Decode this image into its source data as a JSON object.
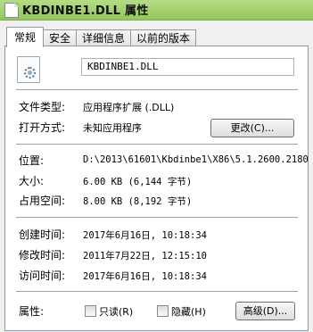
{
  "window": {
    "title": "KBDINBE1.DLL 属性"
  },
  "tabs": [
    {
      "label": "常规",
      "active": true
    },
    {
      "label": "安全",
      "active": false
    },
    {
      "label": "详细信息",
      "active": false
    },
    {
      "label": "以前的版本",
      "active": false
    }
  ],
  "file": {
    "icon": "dll-gear-icon",
    "name": "KBDINBE1.DLL"
  },
  "type": {
    "label": "文件类型:",
    "value": "应用程序扩展 (.DLL)"
  },
  "opens_with": {
    "label": "打开方式:",
    "value": "未知应用程序",
    "change_button": "更改(C)..."
  },
  "location": {
    "label": "位置:",
    "value": "D:\\2013\\61601\\Kbdinbe1\\X86\\5.1.2600.2180"
  },
  "size": {
    "label": "大小:",
    "value": "6.00 KB (6,144 字节)"
  },
  "size_on_disk": {
    "label": "占用空间:",
    "value": "8.00 KB (8,192 字节)"
  },
  "created": {
    "label": "创建时间:",
    "value": "2017年6月16日, 10:18:34"
  },
  "modified": {
    "label": "修改时间:",
    "value": "2011年7月22日, 12:15:10"
  },
  "accessed": {
    "label": "访问时间:",
    "value": "2017年6月16日, 10:18:34"
  },
  "attributes": {
    "label": "属性:",
    "readonly": {
      "label": "只读(R)",
      "checked": false
    },
    "hidden": {
      "label": "隐藏(H)",
      "checked": false
    },
    "advanced_button": "高级(D)..."
  },
  "colors": {
    "titlebar": "#a6d474",
    "panel": "#ffffff",
    "frame": "#f0f0f0"
  }
}
